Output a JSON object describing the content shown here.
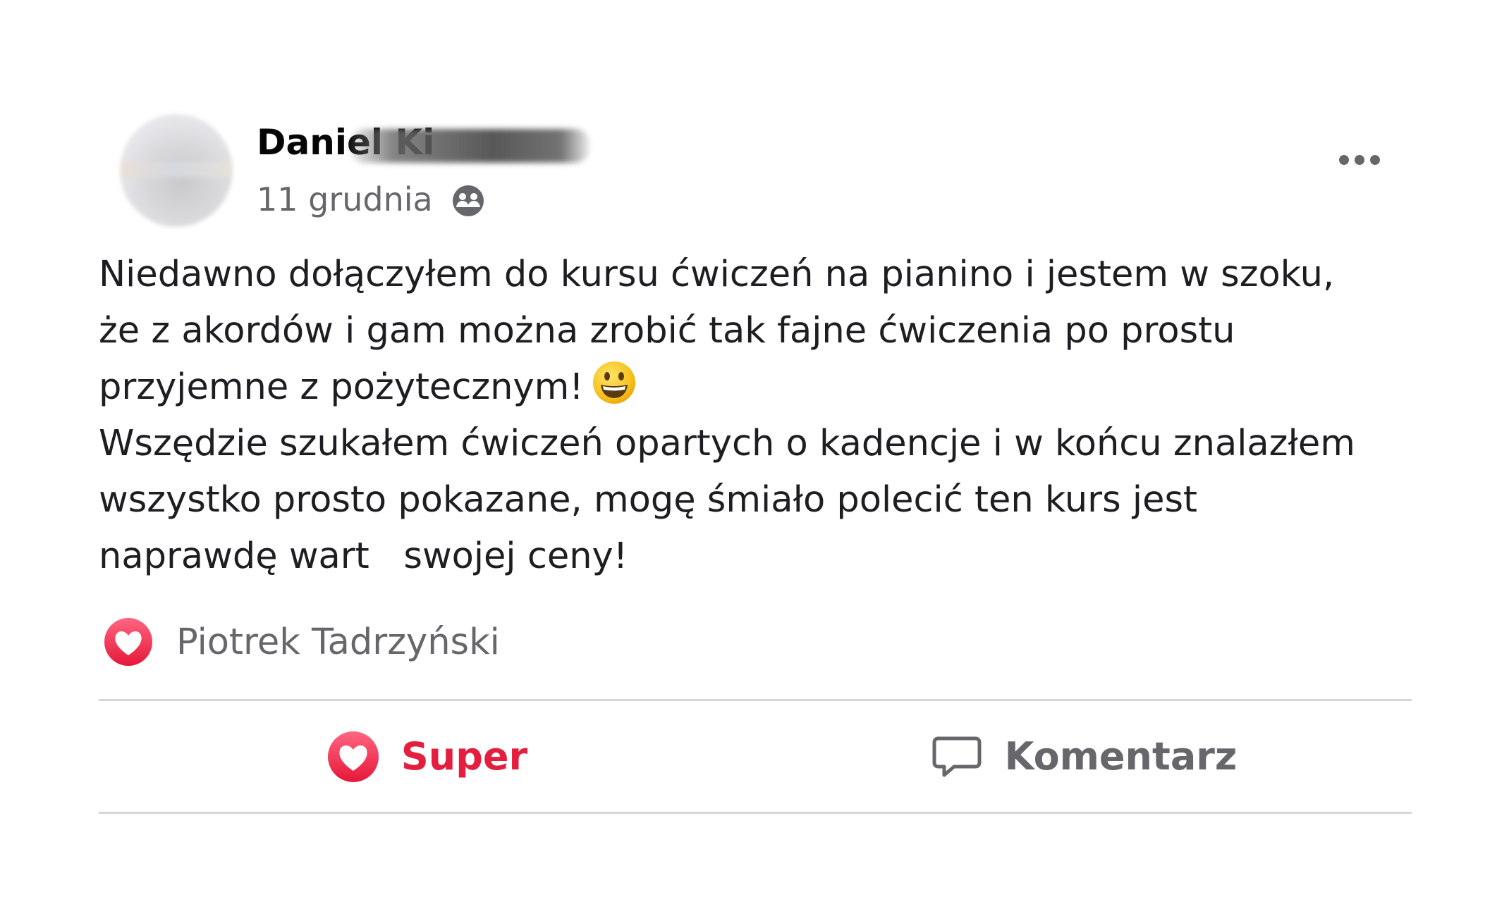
{
  "post": {
    "author": {
      "name": "Daniel Ki"
    },
    "date": "11 grudnia",
    "audience_icon": "friends-icon",
    "body_lines": [
      "Niedawno dołączyłem do kursu ćwiczeń na pianino i jestem w szoku,",
      "że z akordów i gam można zrobić tak fajne ćwiczenia po prostu",
      "przyjemne z pożytecznym!",
      "Wszędzie szukałem ćwiczeń opartych o kadencje i w końcu znalazłem",
      "wszystko prosto pokazane, mogę śmiało polecić ten kurs jest",
      "naprawdę wart   swojej ceny!"
    ],
    "emoji": "grinning-face-emoji",
    "reactions": {
      "icon": "heart-icon",
      "reactor_name": "Piotrek Tadrzyński"
    },
    "actions": {
      "super_label": "Super",
      "comment_label": "Komentarz"
    }
  },
  "colors": {
    "super_red": "#e41e3f",
    "secondary_text": "#65676b",
    "divider": "#d4d6da"
  }
}
